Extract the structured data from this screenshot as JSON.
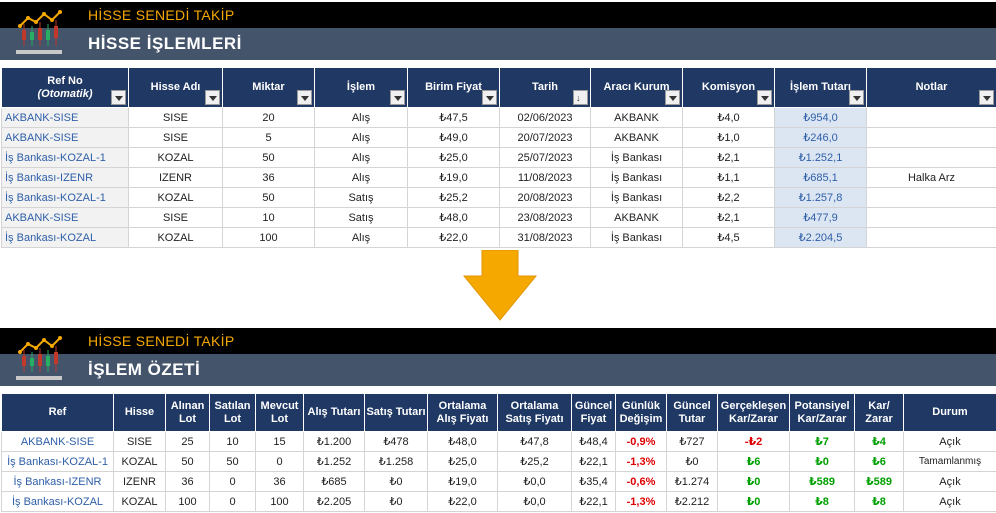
{
  "app_title": "HİSSE SENEDİ TAKİP",
  "section1_title": "HİSSE İŞLEMLERİ",
  "section2_title": "İŞLEM ÖZETİ",
  "colors": {
    "navy": "#1f3864",
    "slate": "#44546a",
    "orange": "#f5a800",
    "red": "#e00000",
    "green": "#00a000"
  },
  "trades": {
    "headers": [
      "Ref No",
      "Hisse Adı",
      "Miktar",
      "İşlem",
      "Birim Fiyat",
      "Tarih",
      "Aracı Kurum",
      "Komisyon",
      "İşlem Tutarı",
      "Notlar"
    ],
    "ref_sub": "(Otomatik)",
    "rows": [
      [
        "AKBANK-SISE",
        "SISE",
        "20",
        "Alış",
        "₺47,5",
        "02/06/2023",
        "AKBANK",
        "₺4,0",
        "₺954,0",
        ""
      ],
      [
        "AKBANK-SISE",
        "SISE",
        "5",
        "Alış",
        "₺49,0",
        "20/07/2023",
        "AKBANK",
        "₺1,0",
        "₺246,0",
        ""
      ],
      [
        "İş Bankası-KOZAL-1",
        "KOZAL",
        "50",
        "Alış",
        "₺25,0",
        "25/07/2023",
        "İş Bankası",
        "₺2,1",
        "₺1.252,1",
        ""
      ],
      [
        "İş Bankası-IZENR",
        "IZENR",
        "36",
        "Alış",
        "₺19,0",
        "11/08/2023",
        "İş Bankası",
        "₺1,1",
        "₺685,1",
        "Halka Arz"
      ],
      [
        "İş Bankası-KOZAL-1",
        "KOZAL",
        "50",
        "Satış",
        "₺25,2",
        "20/08/2023",
        "İş Bankası",
        "₺2,2",
        "₺1.257,8",
        ""
      ],
      [
        "AKBANK-SISE",
        "SISE",
        "10",
        "Satış",
        "₺48,0",
        "23/08/2023",
        "AKBANK",
        "₺2,1",
        "₺477,9",
        ""
      ],
      [
        "İş Bankası-KOZAL",
        "KOZAL",
        "100",
        "Alış",
        "₺22,0",
        "31/08/2023",
        "İş Bankası",
        "₺4,5",
        "₺2.204,5",
        ""
      ]
    ]
  },
  "summary": {
    "headers": [
      [
        "Ref"
      ],
      [
        "Hisse"
      ],
      [
        "Alınan",
        "Lot"
      ],
      [
        "Satılan",
        "Lot"
      ],
      [
        "Mevcut",
        "Lot"
      ],
      [
        "Alış Tutarı"
      ],
      [
        "Satış Tutarı"
      ],
      [
        "Ortalama",
        "Alış Fiyatı"
      ],
      [
        "Ortalama",
        "Satış Fiyatı"
      ],
      [
        "Güncel",
        "Fiyat"
      ],
      [
        "Günlük",
        "Değişim"
      ],
      [
        "Güncel",
        "Tutar"
      ],
      [
        "Gerçekleşen",
        "Kar/Zarar"
      ],
      [
        "Potansiyel",
        "Kar/Zarar"
      ],
      [
        "Kar/",
        "Zarar"
      ],
      [
        "Durum"
      ]
    ],
    "rows": [
      [
        "AKBANK-SISE",
        "SISE",
        "25",
        "10",
        "15",
        "₺1.200",
        "₺478",
        "₺48,0",
        "₺47,8",
        "₺48,4",
        "-0,9%",
        "₺727",
        "-₺2",
        "₺7",
        "₺4",
        "Açık"
      ],
      [
        "İş Bankası-KOZAL-1",
        "KOZAL",
        "50",
        "50",
        "0",
        "₺1.252",
        "₺1.258",
        "₺25,0",
        "₺25,2",
        "₺22,1",
        "-1,3%",
        "₺0",
        "₺6",
        "₺0",
        "₺6",
        "Tamamlanmış"
      ],
      [
        "İş Bankası-IZENR",
        "IZENR",
        "36",
        "0",
        "36",
        "₺685",
        "₺0",
        "₺19,0",
        "₺0,0",
        "₺35,4",
        "-0,6%",
        "₺1.274",
        "₺0",
        "₺589",
        "₺589",
        "Açık"
      ],
      [
        "İş Bankası-KOZAL",
        "KOZAL",
        "100",
        "0",
        "100",
        "₺2.205",
        "₺0",
        "₺22,0",
        "₺0,0",
        "₺22,1",
        "-1,3%",
        "₺2.212",
        "₺0",
        "₺8",
        "₺8",
        "Açık"
      ]
    ]
  }
}
